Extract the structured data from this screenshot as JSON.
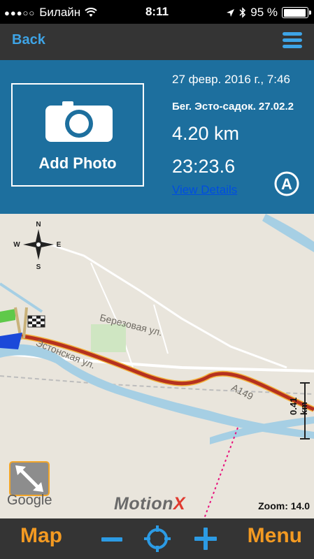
{
  "status_bar": {
    "carrier": "Билайн",
    "time": "8:11",
    "battery": "95 %",
    "battery_level": 0.95,
    "signal_icon": "signal-dots-icon",
    "wifi_icon": "wifi-icon"
  },
  "nav": {
    "back_label": "Back",
    "menu_icon": "hamburger-icon"
  },
  "workout": {
    "add_photo_label": "Add Photo",
    "date": "27 февр. 2016 г., 7:46",
    "name": "Бег. Эсто-садок. 27.02.2",
    "distance": "4.20 km",
    "duration": "23:23.6",
    "view_details": "View Details",
    "badge": "A"
  },
  "map": {
    "compass": {
      "n": "N",
      "s": "S",
      "e": "E",
      "w": "W"
    },
    "streets": [
      "Березовая ул.",
      "Эстонская ул.",
      "А149"
    ],
    "scale_label": "0.41 km",
    "zoom_label": "Zoom: 14.0",
    "google": "Google",
    "brand_a": "Motion",
    "brand_b": "X",
    "route_color": "#b5311f",
    "water_color": "#a6cfe4"
  },
  "bottom_bar": {
    "map_label": "Map",
    "menu_label": "Menu",
    "accent": "#f39a22",
    "icon_color": "#2c9be4"
  }
}
